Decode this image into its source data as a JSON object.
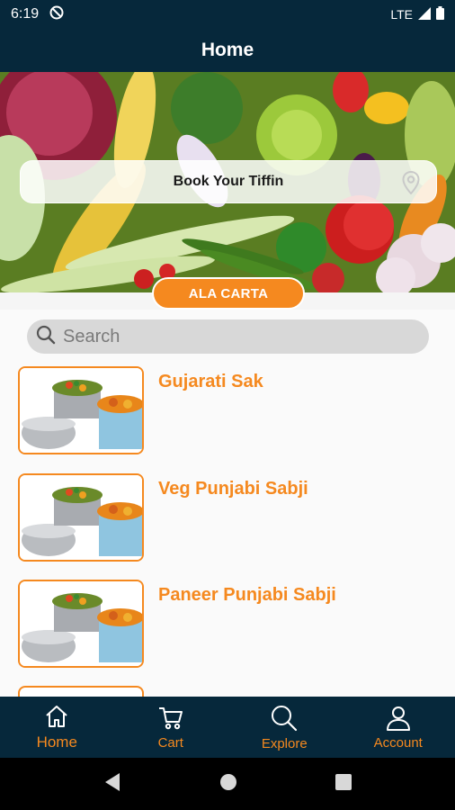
{
  "status_bar": {
    "time": "6:19",
    "network": "LTE"
  },
  "header": {
    "title": "Home"
  },
  "hero": {
    "book_label": "Book Your Tiffin"
  },
  "ala_carta": {
    "label": "ALA CARTA"
  },
  "search": {
    "placeholder": "Search"
  },
  "menu_items": [
    {
      "name": "Gujarati Sak"
    },
    {
      "name": "Veg Punjabi Sabji"
    },
    {
      "name": "Paneer Punjabi Sabji"
    }
  ],
  "bottom_nav": [
    {
      "label": "Home",
      "icon": "home-icon",
      "active": true
    },
    {
      "label": "Cart",
      "icon": "cart-icon"
    },
    {
      "label": "Explore",
      "icon": "search-icon"
    },
    {
      "label": "Account",
      "icon": "account-icon"
    }
  ],
  "colors": {
    "primary": "#06283b",
    "accent": "#f5891f"
  }
}
